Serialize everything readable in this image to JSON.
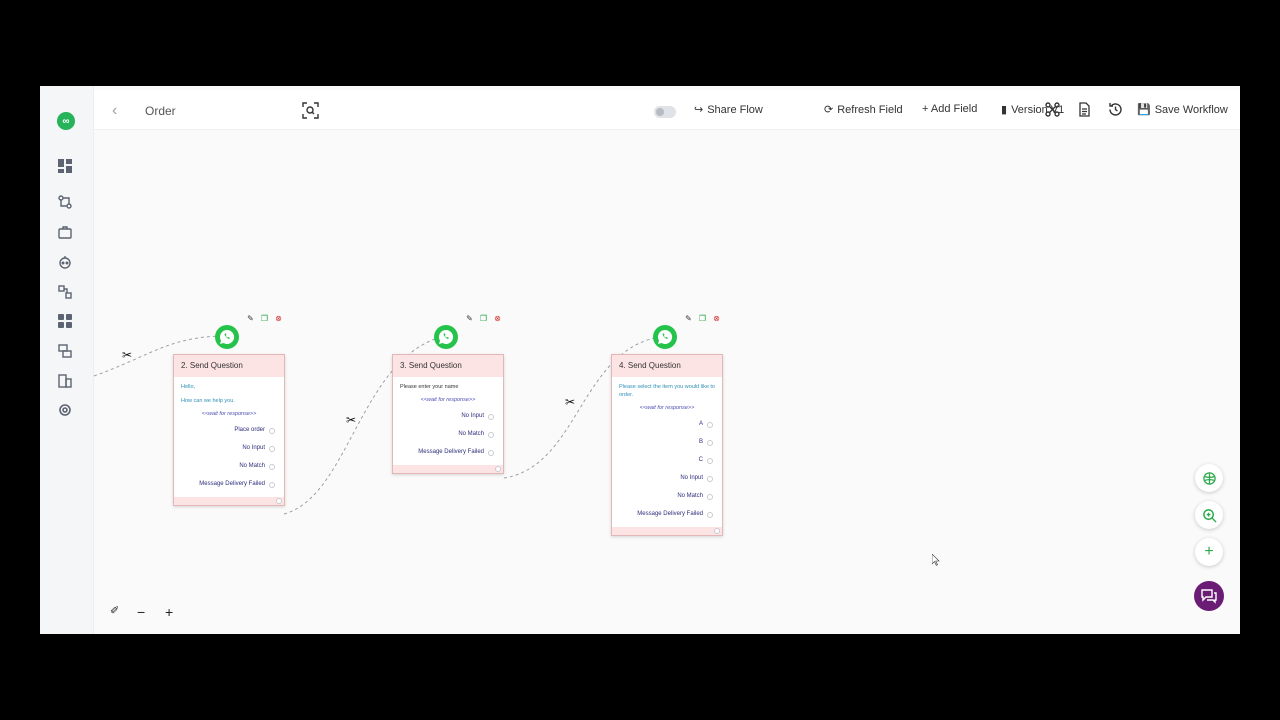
{
  "header": {
    "flow_name": "Order",
    "share": "Share Flow",
    "refresh": "Refresh Field",
    "add_field": "+ Add Field",
    "version": "Version V1",
    "save": "Save Workflow"
  },
  "cards": [
    {
      "title": "2. Send Question",
      "message_lines": [
        "Hello,",
        "How can we help you."
      ],
      "wait": "<<wait for response>>",
      "options": [
        "Place order",
        "No Input",
        "No Match",
        "Message Delivery Failed"
      ]
    },
    {
      "title": "3. Send Question",
      "message_lines": [
        "Please enter your name"
      ],
      "wait": "<<wait for response>>",
      "options": [
        "No Input",
        "No Match",
        "Message Delivery Failed"
      ]
    },
    {
      "title": "4. Send Question",
      "message_lines": [
        "Please select the item you would like to order."
      ],
      "wait": "<<wait for response>>",
      "options": [
        "A",
        "B",
        "C",
        "No Input",
        "No Match",
        "Message Delivery Failed"
      ]
    }
  ],
  "colors": {
    "brand_green": "#27b35a",
    "whatsapp_green": "#25c34c",
    "card_header": "#fde4e4",
    "chat_purple": "#6b1d76"
  },
  "icons": {
    "sidebar": [
      "dashboard-icon",
      "flow-icon",
      "briefcase-icon",
      "bot-icon",
      "integration-icon",
      "apps-icon",
      "templates-icon",
      "building-icon",
      "settings-icon"
    ],
    "fabs": [
      "ai-icon",
      "zoom-search-icon",
      "add-icon",
      "chat-icon"
    ]
  }
}
